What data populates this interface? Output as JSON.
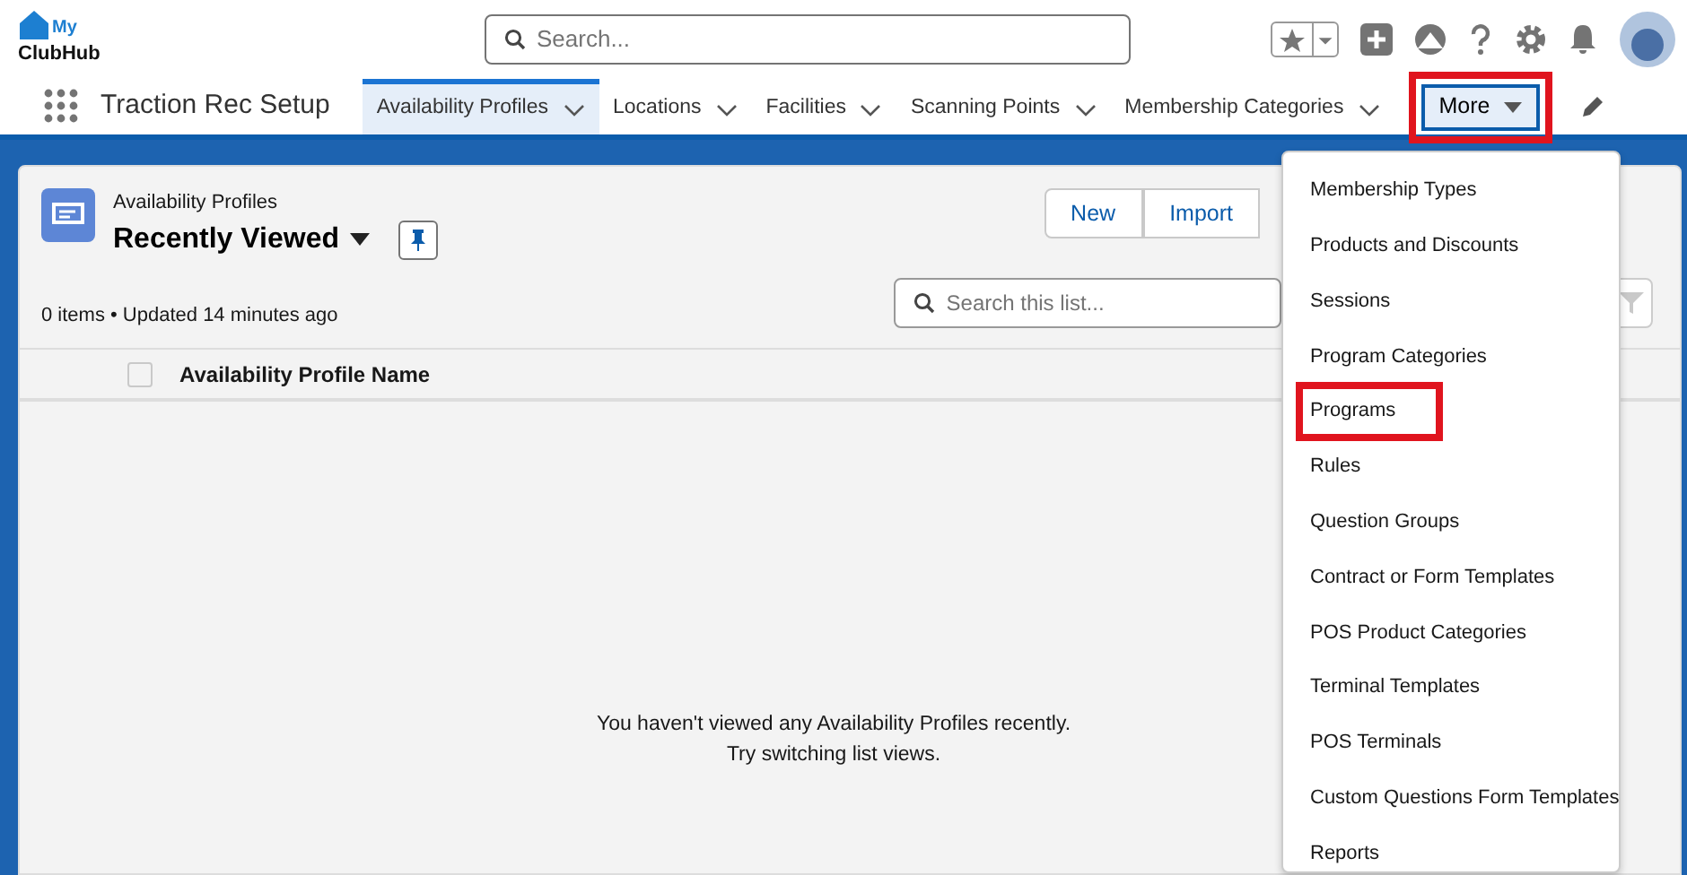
{
  "header": {
    "logo": {
      "line1": "My",
      "line2": "ClubHub"
    },
    "search": {
      "placeholder": "Search..."
    }
  },
  "nav": {
    "app_name": "Traction Rec Setup",
    "tabs": [
      {
        "label": "Availability Profiles",
        "selected": true
      },
      {
        "label": "Locations",
        "selected": false
      },
      {
        "label": "Facilities",
        "selected": false
      },
      {
        "label": "Scanning Points",
        "selected": false
      },
      {
        "label": "Membership Categories",
        "selected": false
      }
    ],
    "more": {
      "label": "More",
      "expanded": true,
      "highlighted": true
    }
  },
  "list_view": {
    "object": "Availability Profiles",
    "view": "Recently Viewed",
    "status": "0 items • Updated 14 minutes ago",
    "buttons": [
      "New",
      "Import"
    ],
    "search": {
      "placeholder": "Search this list..."
    },
    "select_all": {
      "checked": false
    },
    "columns": [
      "Availability Profile Name"
    ],
    "empty_message": [
      "You haven't viewed any Availability Profiles recently.",
      "Try switching list views."
    ]
  },
  "more_menu": {
    "items": [
      {
        "label": "Membership Types",
        "highlighted": false
      },
      {
        "label": "Products and Discounts",
        "highlighted": false
      },
      {
        "label": "Sessions",
        "highlighted": false
      },
      {
        "label": "Program Categories",
        "highlighted": false
      },
      {
        "label": "Programs",
        "highlighted": true
      },
      {
        "label": "Rules",
        "highlighted": false
      },
      {
        "label": "Question Groups",
        "highlighted": false
      },
      {
        "label": "Contract or Form Templates",
        "highlighted": false
      },
      {
        "label": "POS Product Categories",
        "highlighted": false
      },
      {
        "label": "Terminal Templates",
        "highlighted": false
      },
      {
        "label": "POS Terminals",
        "highlighted": false
      },
      {
        "label": "Custom Questions Form Templates",
        "highlighted": false
      },
      {
        "label": "Reports",
        "highlighted": false
      }
    ]
  }
}
